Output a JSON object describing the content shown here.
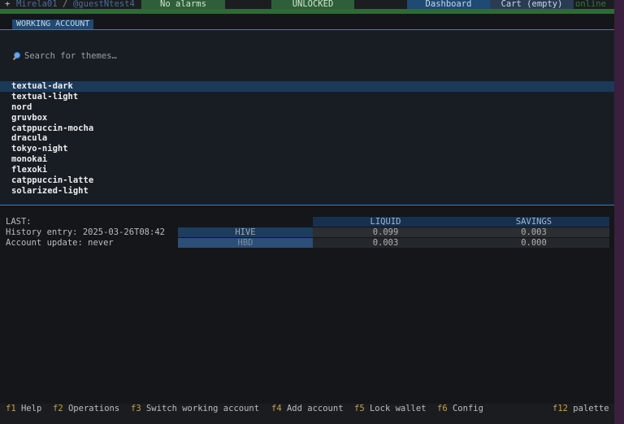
{
  "topbar": {
    "plus": "+",
    "account": "Mirela01",
    "slash": "/",
    "account2": "@guestNtest4",
    "alarms": "No alarms",
    "lock_status": "UNLOCKED",
    "dashboard": "Dashboard",
    "cart": "Cart (empty)",
    "status": "online"
  },
  "tab": {
    "label": "WORKING ACCOUNT"
  },
  "search": {
    "placeholder": "Search for themes…",
    "icon": "search-icon"
  },
  "themes": [
    "textual-dark",
    "textual-light",
    "nord",
    "gruvbox",
    "catppuccin-mocha",
    "dracula",
    "tokyo-night",
    "monokai",
    "flexoki",
    "catppuccin-latte",
    "solarized-light"
  ],
  "selected_theme": "textual-dark",
  "account_info": {
    "last": "LAST:",
    "history": "History entry: 2025-03-26T08:42",
    "update": "Account update: never"
  },
  "balances": {
    "headers": [
      "LIQUID",
      "SAVINGS"
    ],
    "rows": [
      {
        "asset": "HIVE",
        "liquid": "0.099",
        "savings": "0.003"
      },
      {
        "asset": "HBD",
        "liquid": "0.003",
        "savings": "0.000"
      }
    ]
  },
  "bindings": [
    {
      "key": "f1",
      "label": "Help"
    },
    {
      "key": "f2",
      "label": "Operations"
    },
    {
      "key": "f3",
      "label": "Switch working account"
    },
    {
      "key": "f4",
      "label": "Add account"
    },
    {
      "key": "f5",
      "label": "Lock wallet"
    },
    {
      "key": "f6",
      "label": "Config"
    }
  ],
  "palette": {
    "key": "f12",
    "label": "palette"
  },
  "colors": {
    "background": "#141619",
    "accent_blue": "#2f7fd0",
    "status_green": "#2f5f3a",
    "key_yellow": "#c9a24a"
  }
}
